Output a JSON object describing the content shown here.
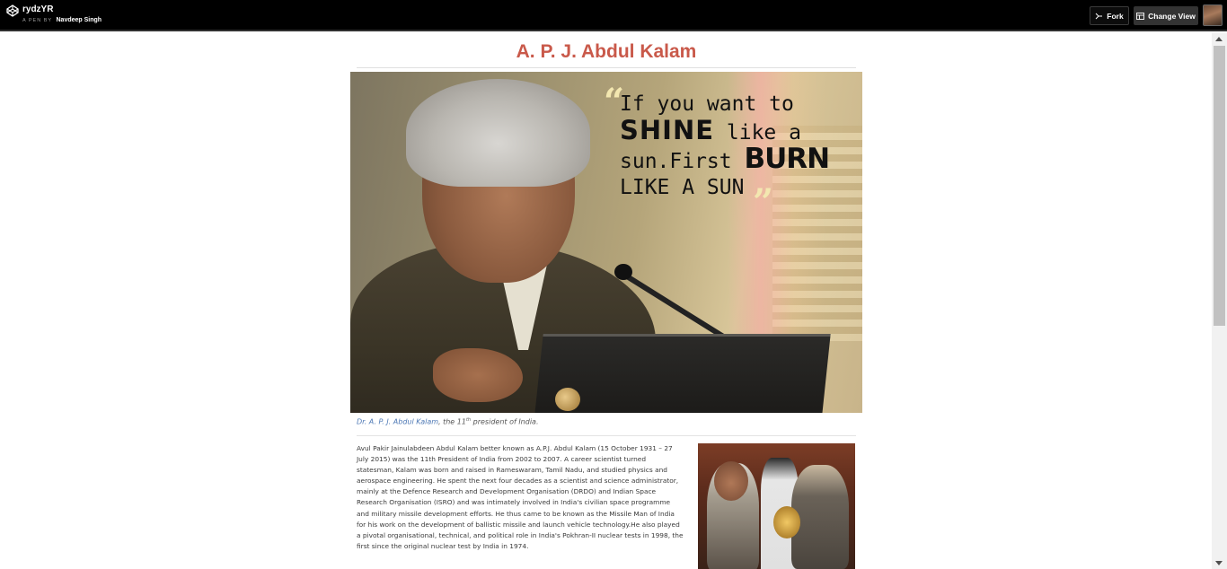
{
  "header": {
    "pen_title": "rydzYR",
    "pen_by_label": "A PEN BY",
    "author": "Navdeep Singh",
    "fork_label": "Fork",
    "change_view_label": "Change View"
  },
  "article": {
    "title": "A. P. J. Abdul Kalam",
    "hero_quote": {
      "open_mark": "“",
      "line1": "If you want to",
      "line2_big": "SHINE",
      "line2_rest": " like a",
      "line3_pre": "sun.First ",
      "line3_big": "BURN",
      "line4": "LIKE A SUN",
      "close_mark": "”"
    },
    "caption": {
      "link_text": "Dr. A. P. J. Abdul Kalam",
      "text_before_sup": ", the 11",
      "sup": "th",
      "text_after_sup": " president of India."
    },
    "bio": "Avul Pakir Jainulabdeen Abdul Kalam better known as A.P.J. Abdul Kalam (15 October 1931 – 27 July 2015) was the 11th President of India from 2002 to 2007. A career scientist turned statesman, Kalam was born and raised in Rameswaram, Tamil Nadu, and studied physics and aerospace engineering. He spent the next four decades as a scientist and science administrator, mainly at the Defence Research and Development Organisation (DRDO) and Indian Space Research Organisation (ISRO) and was intimately involved in India's civilian space programme and military missile development efforts. He thus came to be known as the Missile Man of India for his work on the development of ballistic missile and launch vehicle technology.He also played a pivotal organisational, technical, and political role in India's Pokhran-II nuclear tests in 1998, the first since the original nuclear test by India in 1974."
  },
  "colors": {
    "title": "#c9594a",
    "link": "#4d78b5",
    "topbar": "#000000"
  }
}
